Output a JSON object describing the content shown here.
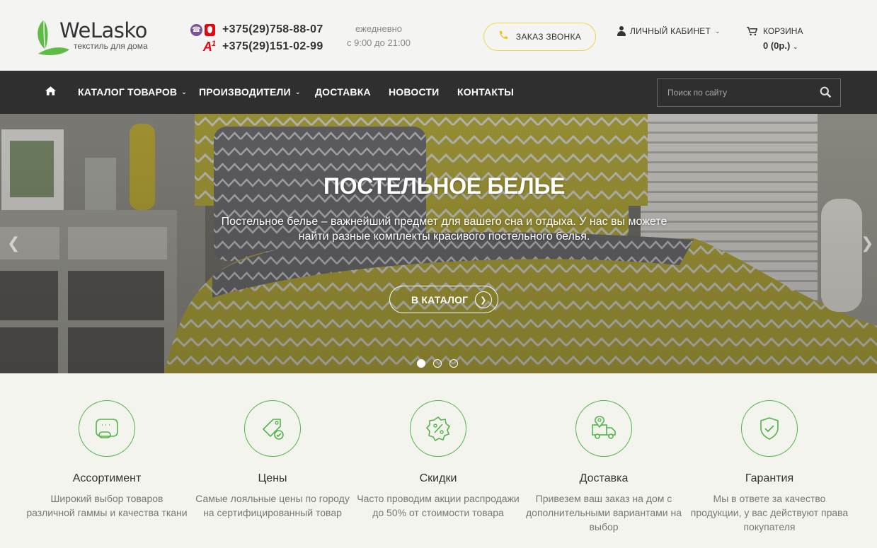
{
  "logo": {
    "name": "WeLasko",
    "tagline": "текстиль для дома"
  },
  "contacts": {
    "phone1": "+375(29)758-88-07",
    "phone2": "+375(29)151-02-99",
    "a1_label": "A",
    "a1_sup": "1",
    "hours_line1": "ежедневно",
    "hours_line2": "с 9:00 до 21:00"
  },
  "header": {
    "callback_label": "ЗАКАЗ ЗВОНКА",
    "account_label": "ЛИЧНЫЙ КАБИНЕТ",
    "cart_label": "КОРЗИНА",
    "cart_total": "0 (0р.)"
  },
  "nav": {
    "items": [
      {
        "label": "КАТАЛОГ ТОВАРОВ",
        "has_dropdown": true
      },
      {
        "label": "ПРОИЗВОДИТЕЛИ",
        "has_dropdown": true
      },
      {
        "label": "ДОСТАВКА",
        "has_dropdown": false
      },
      {
        "label": "НОВОСТИ",
        "has_dropdown": false
      },
      {
        "label": "КОНТАКТЫ",
        "has_dropdown": false
      }
    ],
    "search_placeholder": "Поиск по сайту"
  },
  "slider": {
    "title": "ПОСТЕЛЬНОЕ БЕЛЬЕ",
    "description": "Постельное белье – важнейший предмет для вашего сна и отдыха. У нас вы можете найти разные комплекты красивого постельного белья.",
    "button_label": "В КАТАЛОГ",
    "slides_count": 3,
    "active_slide": 1
  },
  "features": [
    {
      "icon": "fabric-roll-icon",
      "title": "Ассортимент",
      "text": "Широкий выбор товаров различной гаммы и качества ткани"
    },
    {
      "icon": "price-tag-icon",
      "title": "Цены",
      "text": "Самые лояльные цены по городу на сертифицированный товар"
    },
    {
      "icon": "discount-badge-icon",
      "title": "Скидки",
      "text": "Часто проводим акции распродажи до 50% от стоимости товара"
    },
    {
      "icon": "delivery-truck-icon",
      "title": "Доставка",
      "text": "Привезем ваш заказ на дом с дополнительными вариантами на выбор"
    },
    {
      "icon": "shield-check-icon",
      "title": "Гарантия",
      "text": "Мы в ответе за качество продукции, у вас действуют права покупателя"
    }
  ],
  "colors": {
    "accent_green": "#52b44a",
    "nav_bg": "#2f2f2f",
    "callback_border": "#f0d64a",
    "bedding_yellow": "#c8bb3e"
  }
}
